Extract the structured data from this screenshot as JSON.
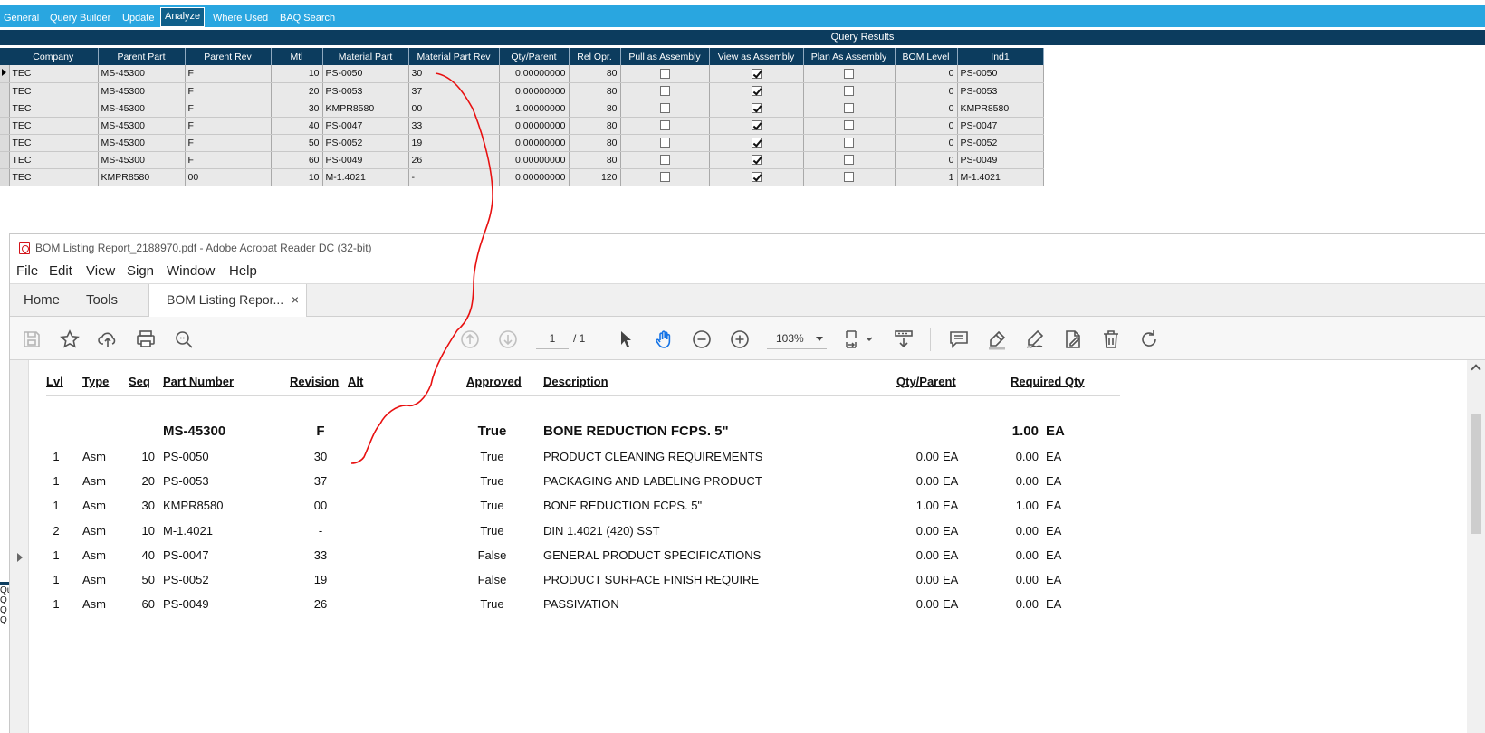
{
  "top_tabs": [
    {
      "label": "General",
      "active": false
    },
    {
      "label": "Query Builder",
      "active": false
    },
    {
      "label": "Update",
      "active": false
    },
    {
      "label": "Analyze",
      "active": true
    },
    {
      "label": "Where Used",
      "active": false
    },
    {
      "label": "BAQ Search",
      "active": false
    }
  ],
  "query_results": {
    "title": "Query Results",
    "columns": [
      "Company",
      "Parent Part",
      "Parent Rev",
      "Mtl",
      "Material Part",
      "Material Part Rev",
      "Qty/Parent",
      "Rel Opr.",
      "Pull as Assembly",
      "View as Assembly",
      "Plan As Assembly",
      "BOM Level",
      "Ind1"
    ],
    "rows": [
      {
        "company": "TEC",
        "parent_part": "MS-45300",
        "parent_rev": "F",
        "mtl": "10",
        "material_part": "PS-0050",
        "material_part_rev": "30",
        "qty_parent": "0.00000000",
        "rel_opr": "80",
        "pull_as_assembly": false,
        "view_as_assembly": true,
        "plan_as_assembly": false,
        "bom_level": "0",
        "ind1": "PS-0050"
      },
      {
        "company": "TEC",
        "parent_part": "MS-45300",
        "parent_rev": "F",
        "mtl": "20",
        "material_part": "PS-0053",
        "material_part_rev": "37",
        "qty_parent": "0.00000000",
        "rel_opr": "80",
        "pull_as_assembly": false,
        "view_as_assembly": true,
        "plan_as_assembly": false,
        "bom_level": "0",
        "ind1": "PS-0053"
      },
      {
        "company": "TEC",
        "parent_part": "MS-45300",
        "parent_rev": "F",
        "mtl": "30",
        "material_part": "KMPR8580",
        "material_part_rev": "00",
        "qty_parent": "1.00000000",
        "rel_opr": "80",
        "pull_as_assembly": false,
        "view_as_assembly": true,
        "plan_as_assembly": false,
        "bom_level": "0",
        "ind1": "KMPR8580"
      },
      {
        "company": "TEC",
        "parent_part": "MS-45300",
        "parent_rev": "F",
        "mtl": "40",
        "material_part": "PS-0047",
        "material_part_rev": "33",
        "qty_parent": "0.00000000",
        "rel_opr": "80",
        "pull_as_assembly": false,
        "view_as_assembly": true,
        "plan_as_assembly": false,
        "bom_level": "0",
        "ind1": "PS-0047"
      },
      {
        "company": "TEC",
        "parent_part": "MS-45300",
        "parent_rev": "F",
        "mtl": "50",
        "material_part": "PS-0052",
        "material_part_rev": "19",
        "qty_parent": "0.00000000",
        "rel_opr": "80",
        "pull_as_assembly": false,
        "view_as_assembly": true,
        "plan_as_assembly": false,
        "bom_level": "0",
        "ind1": "PS-0052"
      },
      {
        "company": "TEC",
        "parent_part": "MS-45300",
        "parent_rev": "F",
        "mtl": "60",
        "material_part": "PS-0049",
        "material_part_rev": "26",
        "qty_parent": "0.00000000",
        "rel_opr": "80",
        "pull_as_assembly": false,
        "view_as_assembly": true,
        "plan_as_assembly": false,
        "bom_level": "0",
        "ind1": "PS-0049"
      },
      {
        "company": "TEC",
        "parent_part": "KMPR8580",
        "parent_rev": "00",
        "mtl": "10",
        "material_part": "M-1.4021",
        "material_part_rev": "-",
        "qty_parent": "0.00000000",
        "rel_opr": "120",
        "pull_as_assembly": false,
        "view_as_assembly": true,
        "plan_as_assembly": false,
        "bom_level": "1",
        "ind1": "M-1.4021"
      }
    ]
  },
  "left_fragments": [
    "Qu",
    "Q",
    "Q",
    "Q"
  ],
  "acrobat": {
    "window_title": "BOM Listing Report_2188970.pdf - Adobe Acrobat Reader DC (32-bit)",
    "menu": [
      "File",
      "Edit",
      "View",
      "Sign",
      "Window",
      "Help"
    ],
    "home_tab": "Home",
    "tools_tab": "Tools",
    "doc_tab": "BOM Listing Repor...",
    "doc_tab_close": "×",
    "page_current": "1",
    "page_total": "/ 1",
    "zoom": "103%",
    "icons": [
      "save-icon",
      "star-icon",
      "upload-icon",
      "print-icon",
      "search-zoom-icon",
      "prev-page-icon",
      "next-page-icon",
      "select-arrow-icon",
      "hand-icon",
      "zoom-out-icon",
      "zoom-in-icon",
      "fit-page-icon",
      "scroll-mode-icon",
      "comment-icon",
      "highlight-icon",
      "sign-icon",
      "edit-pdf-icon",
      "delete-icon",
      "rotate-icon"
    ]
  },
  "report": {
    "headers": {
      "lvl": "Lvl",
      "type": "Type",
      "seq": "Seq",
      "part_number": "Part Number",
      "revision": "Revision",
      "alt": "Alt",
      "approved": "Approved",
      "description": "Description",
      "qty_parent": "Qty/Parent",
      "required_qty": "Required Qty"
    },
    "parent": {
      "part_number": "MS-45300",
      "revision": "F",
      "approved": "True",
      "description": "BONE REDUCTION FCPS. 5\"",
      "required_qty": "1.00",
      "required_uom": "EA"
    },
    "lines": [
      {
        "lvl": "1",
        "type": "Asm",
        "seq": "10",
        "part_number": "PS-0050",
        "revision": "30",
        "approved": "True",
        "description": "PRODUCT CLEANING REQUIREMENTS",
        "qty_parent": "0.00",
        "qty_uom": "EA",
        "required_qty": "0.00",
        "required_uom": "EA"
      },
      {
        "lvl": "1",
        "type": "Asm",
        "seq": "20",
        "part_number": "PS-0053",
        "revision": "37",
        "approved": "True",
        "description": "PACKAGING AND LABELING PRODUCT",
        "qty_parent": "0.00",
        "qty_uom": "EA",
        "required_qty": "0.00",
        "required_uom": "EA"
      },
      {
        "lvl": "1",
        "type": "Asm",
        "seq": "30",
        "part_number": "KMPR8580",
        "revision": "00",
        "approved": "True",
        "description": "BONE REDUCTION FCPS. 5\"",
        "qty_parent": "1.00",
        "qty_uom": "EA",
        "required_qty": "1.00",
        "required_uom": "EA"
      },
      {
        "lvl": "2",
        "type": "Asm",
        "seq": "10",
        "part_number": "M-1.4021",
        "revision": "-",
        "approved": "True",
        "description": "DIN 1.4021 (420) SST",
        "qty_parent": "0.00",
        "qty_uom": "EA",
        "required_qty": "0.00",
        "required_uom": "EA"
      },
      {
        "lvl": "1",
        "type": "Asm",
        "seq": "40",
        "part_number": "PS-0047",
        "revision": "33",
        "approved": "False",
        "description": "GENERAL PRODUCT SPECIFICATIONS",
        "qty_parent": "0.00",
        "qty_uom": "EA",
        "required_qty": "0.00",
        "required_uom": "EA"
      },
      {
        "lvl": "1",
        "type": "Asm",
        "seq": "50",
        "part_number": "PS-0052",
        "revision": "19",
        "approved": "False",
        "description": "PRODUCT SURFACE FINISH REQUIRE",
        "qty_parent": "0.00",
        "qty_uom": "EA",
        "required_qty": "0.00",
        "required_uom": "EA"
      },
      {
        "lvl": "1",
        "type": "Asm",
        "seq": "60",
        "part_number": "PS-0049",
        "revision": "26",
        "approved": "True",
        "description": "PASSIVATION",
        "qty_parent": "0.00",
        "qty_uom": "EA",
        "required_qty": "0.00",
        "required_uom": "EA"
      }
    ]
  },
  "colors": {
    "top_bar": "#29a6e0",
    "grid_header": "#0c3c5e",
    "annotation": "#e81010",
    "hand_tool": "#1473e6"
  }
}
